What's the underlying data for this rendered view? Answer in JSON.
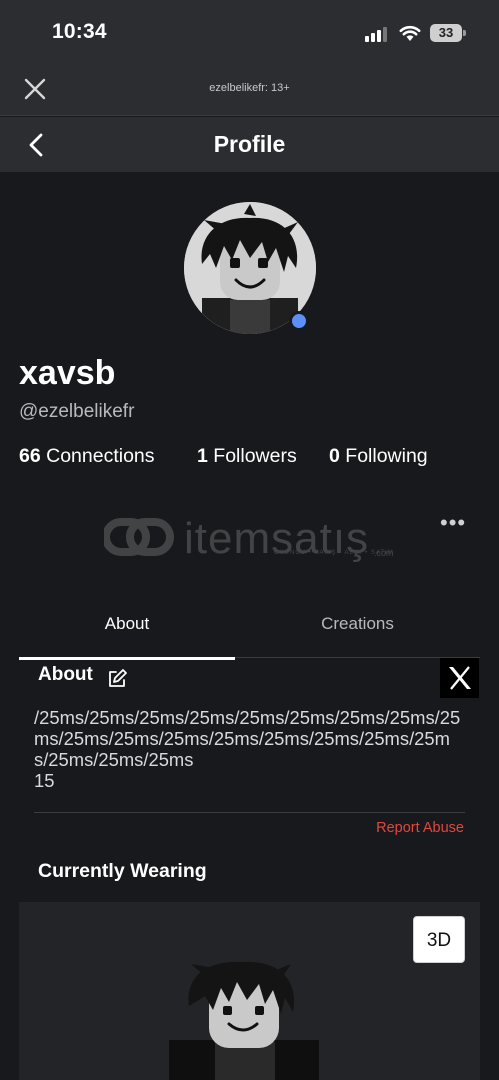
{
  "status_bar": {
    "time": "10:34",
    "battery": "33"
  },
  "browser": {
    "site_label": "ezelbelikefr: 13+"
  },
  "nav": {
    "title": "Profile"
  },
  "profile": {
    "display_name": "xavsb",
    "username": "@ezelbelikefr",
    "online": true,
    "stats": [
      {
        "count": "66",
        "label": "Connections"
      },
      {
        "count": "1",
        "label": "Followers"
      },
      {
        "count": "0",
        "label": "Following"
      }
    ]
  },
  "watermark": {
    "text": "itemsatış",
    "sub": "OYUNCU • SATIŞ • ALIM • SATIM",
    "domain": ".com"
  },
  "more_menu": "•••",
  "tabs": [
    {
      "label": "About",
      "active": true
    },
    {
      "label": "Creations",
      "active": false
    }
  ],
  "about": {
    "heading": "About",
    "bio": "/25ms/25ms/25ms/25ms/25ms/25ms/25ms/25ms/25ms/25ms/25ms/25ms/25ms/25ms/25ms/25ms/25ms/25ms/25ms/25ms\n15",
    "report_label": "Report Abuse"
  },
  "wearing": {
    "heading": "Currently Wearing",
    "view_3d_label": "3D"
  },
  "colors": {
    "background": "#18191c",
    "bar": "#2b2d31",
    "online": "#5b8ff9",
    "report": "#e2473f"
  }
}
